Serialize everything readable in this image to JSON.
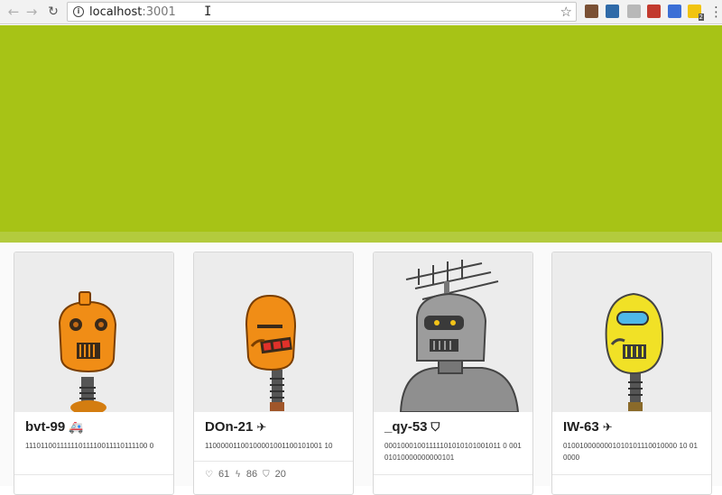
{
  "browser": {
    "url_host": "localhost",
    "url_port": ":3001",
    "extension_badge": "2"
  },
  "colors": {
    "hero": "#a7c316",
    "card_bg": "#ffffff",
    "image_bg": "#ececec"
  },
  "cards": [
    {
      "name": "bvt-99",
      "type_icon": "ambulance-icon",
      "type_glyph": "🚑",
      "bits": "11101100111111011110011110111100 0"
    },
    {
      "name": "DOn-21",
      "type_icon": "plane-icon",
      "type_glyph": "✈",
      "bits": "11000001100100001001100101001 10",
      "stats": {
        "health": "61",
        "energy": "86",
        "shield": "20"
      }
    },
    {
      "name": "_qy-53",
      "type_icon": "shield-icon",
      "type_glyph": "⛉",
      "bits": "00010001001111101010101001011 0 00101010000000000101"
    },
    {
      "name": "IW-63",
      "type_icon": "plane-icon",
      "type_glyph": "✈",
      "bits": "0100100000001010101110010000 10 010000"
    }
  ]
}
